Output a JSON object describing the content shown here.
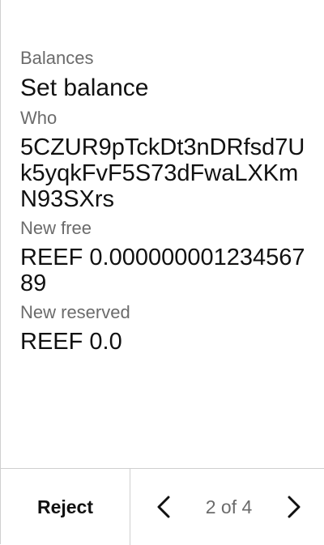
{
  "call": {
    "module": "Balances",
    "method": "Set balance"
  },
  "fields": [
    {
      "label": "Who",
      "value": "5CZUR9pTckDt3nDRfsd7Uk5yqkFvF5S73dFwaLXKmN93SXrs"
    },
    {
      "label": "New free",
      "value": "REEF 0.00000000123456789"
    },
    {
      "label": "New reserved",
      "value": "REEF 0.0"
    }
  ],
  "footer": {
    "reject_label": "Reject",
    "page_counter": "2 of 4",
    "prev_icon": "chevron-left-icon",
    "next_icon": "chevron-right-icon"
  }
}
